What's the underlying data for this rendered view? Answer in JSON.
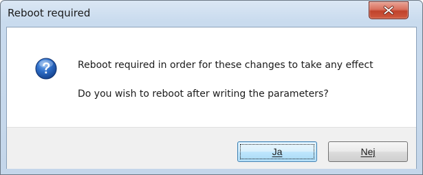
{
  "window": {
    "title": "Reboot required"
  },
  "message": {
    "line1": "Reboot required in order for these changes to take any effect",
    "line2": "Do you wish to reboot after writing the parameters?",
    "icon": "question-icon"
  },
  "buttons": {
    "yes_label": "Ja",
    "no_label": "Nej"
  },
  "colors": {
    "close_button": "#c74a32",
    "yes_button_border": "#3c7fb1",
    "footer_background": "#f0f0f0"
  }
}
